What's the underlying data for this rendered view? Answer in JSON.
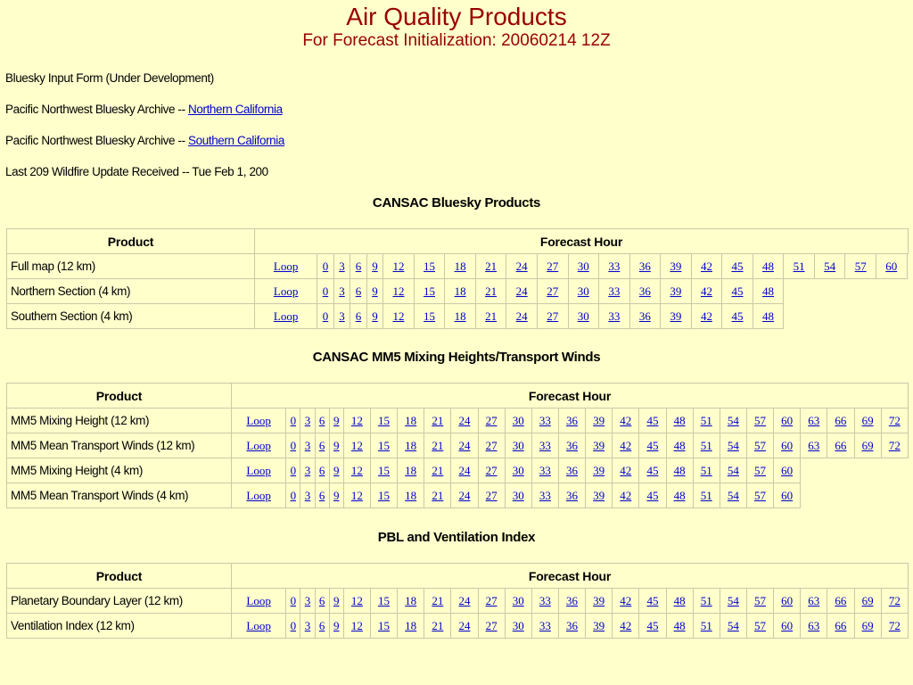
{
  "header": {
    "title": "Air Quality Products",
    "subtitle": "For Forecast Initialization: 20060214 12Z"
  },
  "lines": {
    "input_form": "Bluesky Input Form (Under Development)",
    "archive_prefix": "Pacific Northwest Bluesky Archive --",
    "northern_link": "Northern California",
    "southern_link": "Southern California",
    "wildfire_update": "Last 209 Wildfire Update Received -- Tue Feb 1, 200"
  },
  "tables": [
    {
      "title": "CANSAC Bluesky Products",
      "product_header": "Product",
      "forecast_header": "Forecast Hour",
      "max_links": 23,
      "rows": [
        {
          "name": "Full map (12 km)",
          "links": [
            "Loop",
            "0",
            "3",
            "6",
            "9",
            "12",
            "15",
            "18",
            "21",
            "24",
            "27",
            "30",
            "33",
            "36",
            "39",
            "42",
            "45",
            "48",
            "51",
            "54",
            "57",
            "60"
          ]
        },
        {
          "name": "Northern Section (4 km)",
          "links": [
            "Loop",
            "0",
            "3",
            "6",
            "9",
            "12",
            "15",
            "18",
            "21",
            "24",
            "27",
            "30",
            "33",
            "36",
            "39",
            "42",
            "45",
            "48"
          ]
        },
        {
          "name": "Southern Section (4 km)",
          "links": [
            "Loop",
            "0",
            "3",
            "6",
            "9",
            "12",
            "15",
            "18",
            "21",
            "24",
            "27",
            "30",
            "33",
            "36",
            "39",
            "42",
            "45",
            "48"
          ]
        }
      ]
    },
    {
      "title": "CANSAC MM5 Mixing Heights/Transport Winds",
      "product_header": "Product",
      "forecast_header": "Forecast Hour",
      "max_links": 26,
      "rows": [
        {
          "name": "MM5 Mixing Height (12 km)",
          "links": [
            "Loop",
            "0",
            "3",
            "6",
            "9",
            "12",
            "15",
            "18",
            "21",
            "24",
            "27",
            "30",
            "33",
            "36",
            "39",
            "42",
            "45",
            "48",
            "51",
            "54",
            "57",
            "60",
            "63",
            "66",
            "69",
            "72"
          ]
        },
        {
          "name": "MM5 Mean Transport Winds (12 km)",
          "links": [
            "Loop",
            "0",
            "3",
            "6",
            "9",
            "12",
            "15",
            "18",
            "21",
            "24",
            "27",
            "30",
            "33",
            "36",
            "39",
            "42",
            "45",
            "48",
            "51",
            "54",
            "57",
            "60",
            "63",
            "66",
            "69",
            "72"
          ]
        },
        {
          "name": "MM5 Mixing Height (4 km)",
          "links": [
            "Loop",
            "0",
            "3",
            "6",
            "9",
            "12",
            "15",
            "18",
            "21",
            "24",
            "27",
            "30",
            "33",
            "36",
            "39",
            "42",
            "45",
            "48",
            "51",
            "54",
            "57",
            "60"
          ]
        },
        {
          "name": "MM5 Mean Transport Winds (4 km)",
          "links": [
            "Loop",
            "0",
            "3",
            "6",
            "9",
            "12",
            "15",
            "18",
            "21",
            "24",
            "27",
            "30",
            "33",
            "36",
            "39",
            "42",
            "45",
            "48",
            "51",
            "54",
            "57",
            "60"
          ]
        }
      ]
    },
    {
      "title": "PBL and Ventilation Index",
      "product_header": "Product",
      "forecast_header": "Forecast Hour",
      "max_links": 26,
      "rows": [
        {
          "name": "Planetary Boundary Layer (12 km)",
          "links": [
            "Loop",
            "0",
            "3",
            "6",
            "9",
            "12",
            "15",
            "18",
            "21",
            "24",
            "27",
            "30",
            "33",
            "36",
            "39",
            "42",
            "45",
            "48",
            "51",
            "54",
            "57",
            "60",
            "63",
            "66",
            "69",
            "72"
          ]
        },
        {
          "name": "Ventilation Index (12 km)",
          "links": [
            "Loop",
            "0",
            "3",
            "6",
            "9",
            "12",
            "15",
            "18",
            "21",
            "24",
            "27",
            "30",
            "33",
            "36",
            "39",
            "42",
            "45",
            "48",
            "51",
            "54",
            "57",
            "60",
            "63",
            "66",
            "69",
            "72"
          ]
        }
      ]
    }
  ]
}
